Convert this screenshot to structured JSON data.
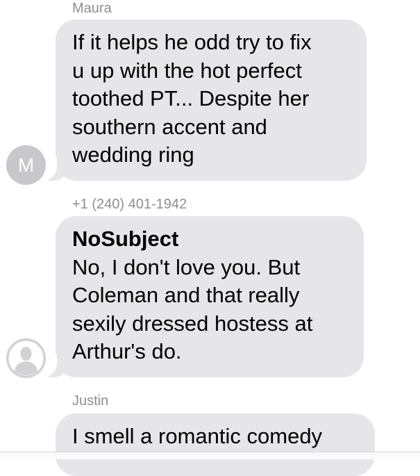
{
  "messages": [
    {
      "sender": "Maura",
      "avatar_initial": "M",
      "lines": [
        "If it helps he odd try to fix",
        "u up with the hot perfect",
        "toothed PT... Despite her",
        "southern accent and",
        "wedding ring"
      ]
    },
    {
      "sender": "+1 (240) 401-1942",
      "avatar_icon": "person-silhouette-icon",
      "subject": "NoSubject",
      "lines": [
        "No, I don't love you.  But",
        "Coleman and that really",
        "sexily dressed hostess at",
        "Arthur's do."
      ]
    },
    {
      "sender": "Justin",
      "lines": [
        "I smell a romantic comedy"
      ]
    }
  ],
  "colors": {
    "bubble_incoming": "#e5e5ea",
    "sender_label": "#8e8e93",
    "avatar_bg": "#c7c7cc"
  }
}
